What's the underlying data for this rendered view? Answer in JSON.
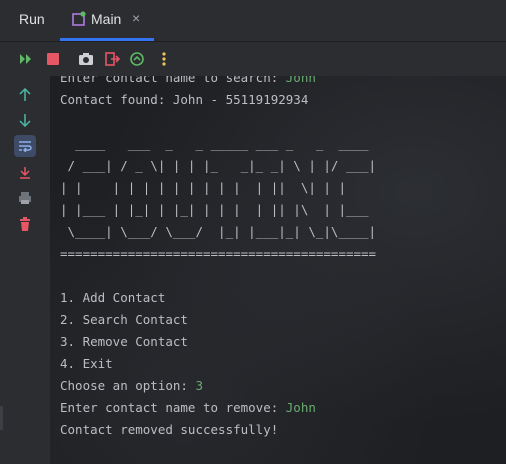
{
  "tool_window": {
    "title": "Run"
  },
  "tab": {
    "label": "Main",
    "close": "×"
  },
  "toolbar": {
    "icons": [
      "rerun-icon",
      "stop-icon",
      "screenshot-icon",
      "exit-icon",
      "debug-icon",
      "more-icon"
    ],
    "colors": {
      "rerun": "#5fb865",
      "stop": "#e55765",
      "exit": "#e55765",
      "debug": "#5fb865",
      "more": "#f2c55c"
    }
  },
  "sidebar": {
    "icons": [
      "up-icon",
      "down-icon",
      "soft-wrap-icon",
      "scroll-to-end-icon",
      "print-icon",
      "clear-icon"
    ]
  },
  "console": {
    "lines": [
      {
        "text": "Enter contact name to search: ",
        "input": "John"
      },
      {
        "text": "Contact found: John - 55119192934",
        "input": ""
      },
      {
        "text": "",
        "input": ""
      },
      {
        "text": "  ____   ___  _   _ _____ ___ _   _  ____ ",
        "input": ""
      },
      {
        "text": " / ___| / _ \\| | | |_   _|_ _| \\ | |/ ___|",
        "input": ""
      },
      {
        "text": "| |    | | | | | | | | |  | ||  \\| | |    ",
        "input": ""
      },
      {
        "text": "| |___ | |_| | |_| | | |  | || |\\  | |___ ",
        "input": ""
      },
      {
        "text": " \\____| \\___/ \\___/  |_| |___|_| \\_|\\____|",
        "input": ""
      },
      {
        "text": "==========================================",
        "input": ""
      },
      {
        "text": "",
        "input": ""
      },
      {
        "text": "1. Add Contact",
        "input": ""
      },
      {
        "text": "2. Search Contact",
        "input": ""
      },
      {
        "text": "3. Remove Contact",
        "input": ""
      },
      {
        "text": "4. Exit",
        "input": ""
      },
      {
        "text": "Choose an option: ",
        "input": "3"
      },
      {
        "text": "Enter contact name to remove: ",
        "input": "John"
      },
      {
        "text": "Contact removed successfully!",
        "input": ""
      }
    ]
  }
}
